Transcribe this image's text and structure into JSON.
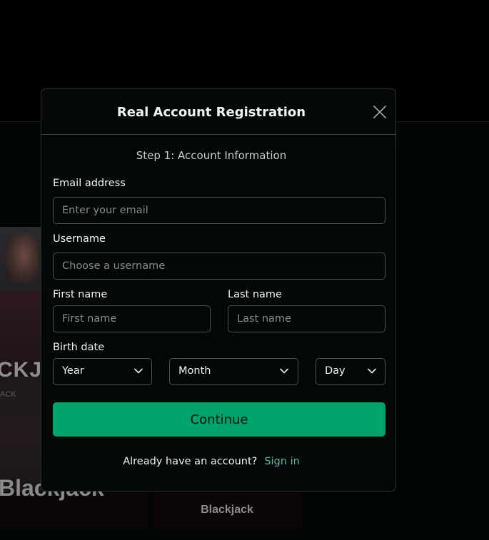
{
  "background": {
    "thumb_text": "CKJ",
    "thumb_sub": "ACK",
    "card_title": "Blackjack",
    "card2_label": "Blackjack"
  },
  "modal": {
    "title": "Real Account Registration",
    "step": "Step 1: Account Information",
    "email": {
      "label": "Email address",
      "placeholder": "Enter your email",
      "value": ""
    },
    "username": {
      "label": "Username",
      "placeholder": "Choose a username",
      "value": ""
    },
    "first_name": {
      "label": "First name",
      "placeholder": "First name",
      "value": ""
    },
    "last_name": {
      "label": "Last name",
      "placeholder": "Last name",
      "value": ""
    },
    "birth_date": {
      "label": "Birth date",
      "year": "Year",
      "month": "Month",
      "day": "Day"
    },
    "continue_label": "Continue",
    "footer_text": "Already have an account?",
    "signin_label": "Sign in"
  },
  "colors": {
    "accent": "#00a36c",
    "link": "#5fb3a8",
    "modal_bg": "#030807",
    "border": "#4b5351"
  }
}
